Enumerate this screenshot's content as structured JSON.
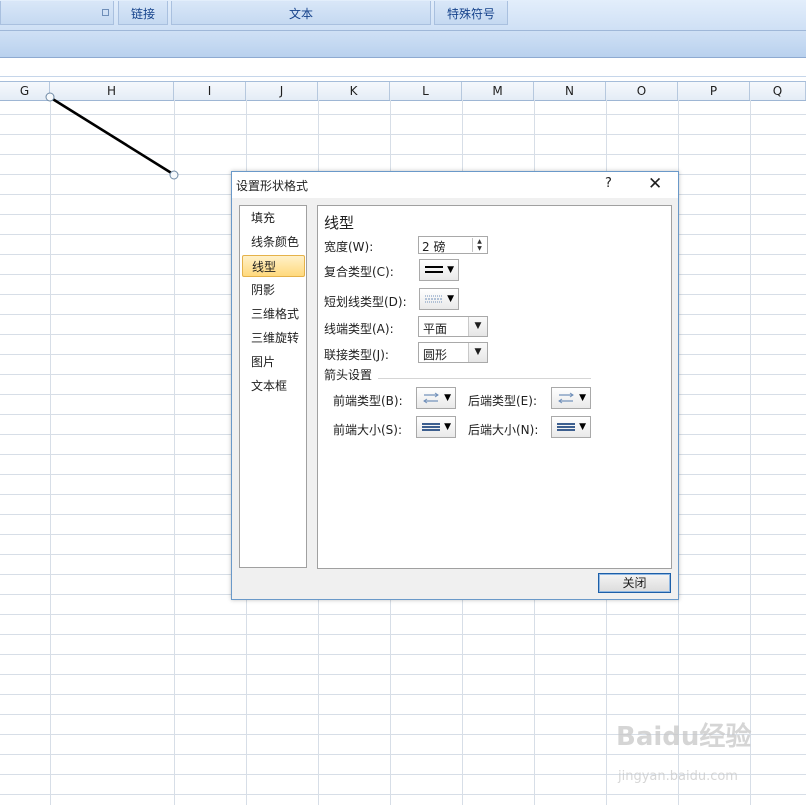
{
  "ribbon": {
    "groups": [
      {
        "label": ""
      },
      {
        "label": "链接"
      },
      {
        "label": "文本"
      },
      {
        "label": "特殊符号"
      }
    ]
  },
  "sheet": {
    "columns": [
      "G",
      "H",
      "I",
      "J",
      "K",
      "L",
      "M",
      "N",
      "O",
      "P",
      "Q"
    ]
  },
  "dialog": {
    "title": "设置形状格式",
    "help": "?",
    "close_glyph": "✕",
    "nav": [
      "填充",
      "线条颜色",
      "线型",
      "阴影",
      "三维格式",
      "三维旋转",
      "图片",
      "文本框"
    ],
    "selected_nav": "线型",
    "section_title": "线型",
    "width_label": "宽度(W):",
    "width_value": "2 磅",
    "compound_label": "复合类型(C):",
    "dash_label": "短划线类型(D):",
    "cap_label": "线端类型(A):",
    "cap_value": "平面",
    "join_label": "联接类型(J):",
    "join_value": "圆形",
    "arrow_section": "箭头设置",
    "begin_type_label": "前端类型(B):",
    "end_type_label": "后端类型(E):",
    "begin_size_label": "前端大小(S):",
    "end_size_label": "后端大小(N):",
    "close_label": "关闭"
  },
  "watermark": {
    "brand": "Baidu经验",
    "url": "jingyan.baidu.com"
  }
}
